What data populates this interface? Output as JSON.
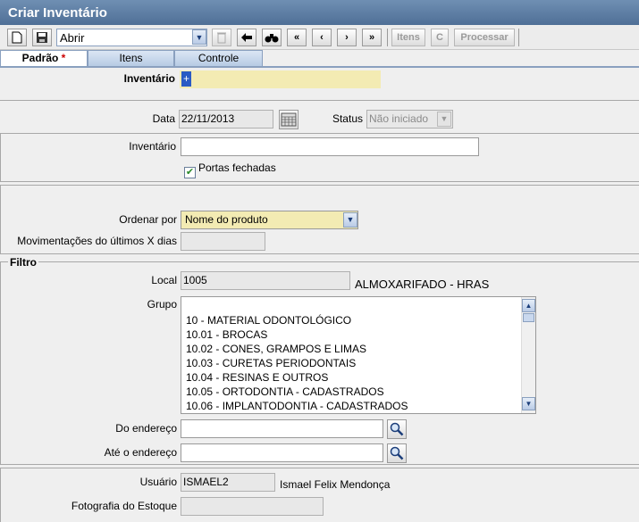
{
  "window": {
    "title": "Criar Inventário"
  },
  "toolbar": {
    "action_select": "Abrir",
    "itens_label": "Itens",
    "c_label": "C",
    "processar_label": "Processar"
  },
  "tabs": [
    {
      "label": "Padrão",
      "required_mark": "*"
    },
    {
      "label": "Itens"
    },
    {
      "label": "Controle"
    }
  ],
  "header": {
    "inventario_label": "Inventário",
    "inventario_value": "+"
  },
  "dates": {
    "data_label": "Data",
    "data_value": "22/11/2013",
    "status_label": "Status",
    "status_value": "Não iniciado"
  },
  "section1": {
    "inventario_label": "Inventário",
    "inventario_value": "",
    "portas_label": "Portas fechadas",
    "portas_checked": true
  },
  "section2": {
    "ordenar_label": "Ordenar por",
    "ordenar_value": "Nome do produto",
    "mov_label": "Movimentações do últimos X dias",
    "mov_value": ""
  },
  "filtro": {
    "legend": "Filtro",
    "local_label": "Local",
    "local_code": "1005",
    "local_name": "ALMOXARIFADO - HRAS",
    "grupo_label": "Grupo",
    "grupo_items": [
      "10 - MATERIAL ODONTOLÓGICO",
      "10.01 - BROCAS",
      "10.02 - CONES, GRAMPOS E LIMAS",
      "10.03 - CURETAS PERIODONTAIS",
      "10.04 - RESINAS E OUTROS",
      "10.05 - ORTODONTIA - CADASTRADOS",
      "10.06 - IMPLANTODONTIA - CADASTRADOS"
    ],
    "do_endereco_label": "Do endereço",
    "do_endereco_value": "",
    "ate_endereco_label": "Até o endereço",
    "ate_endereco_value": ""
  },
  "footer": {
    "usuario_label": "Usuário",
    "usuario_code": "ISMAEL2",
    "usuario_name": "Ismael Felix Mendonça",
    "fotografia_label": "Fotografia do Estoque",
    "fotografia_value": ""
  }
}
